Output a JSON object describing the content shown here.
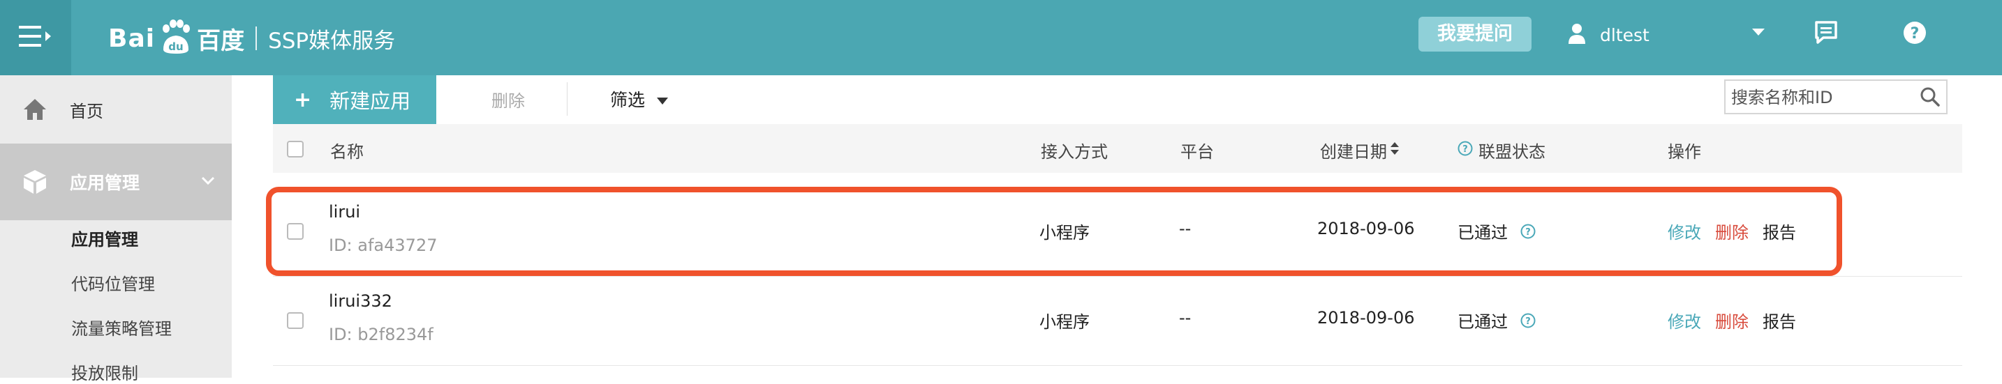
{
  "header": {
    "logo_latin": "Bai",
    "logo_du": "du",
    "logo_cn": "百度",
    "service_name": "SSP媒体服务",
    "help_button": "我要提问",
    "username": "dltest"
  },
  "sidebar": {
    "home": "首页",
    "app_management": "应用管理",
    "sub_items": [
      "应用管理",
      "代码位管理",
      "流量策略管理",
      "投放限制"
    ]
  },
  "toolbar": {
    "new_app": "新建应用",
    "delete": "删除",
    "filter": "筛选",
    "search_placeholder": "搜索名称和ID"
  },
  "table": {
    "columns": [
      "名称",
      "接入方式",
      "平台",
      "创建日期",
      "联盟状态",
      "操作"
    ],
    "rows": [
      {
        "name": "lirui",
        "id": "ID: afa43727",
        "access": "小程序",
        "platform": "--",
        "date": "2018-09-06",
        "status": "已通过",
        "edit": "修改",
        "delete": "删除",
        "report": "报告"
      },
      {
        "name": "lirui332",
        "id": "ID: b2f8234f",
        "access": "小程序",
        "platform": "--",
        "date": "2018-09-06",
        "status": "已通过",
        "edit": "修改",
        "delete": "删除",
        "report": "报告"
      }
    ]
  },
  "colors": {
    "header_bg": "#4ba7b2",
    "accent": "#50b1bb",
    "highlight_border": "#f0522c",
    "delete_red": "#d84b3c"
  }
}
